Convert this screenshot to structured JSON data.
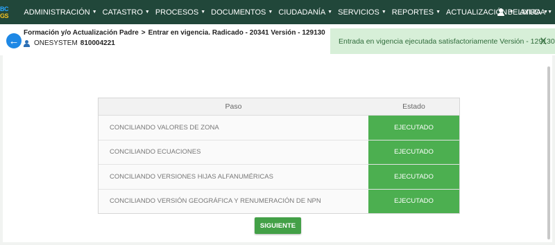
{
  "app": {
    "logo_line1": "BC",
    "logo_line2": "GS"
  },
  "nav": {
    "items": [
      {
        "label": "ADMINISTRACIÓN"
      },
      {
        "label": "CATASTRO"
      },
      {
        "label": "PROCESOS"
      },
      {
        "label": "DOCUMENTOS"
      },
      {
        "label": "CIUDADANÍA"
      },
      {
        "label": "SERVICIOS"
      },
      {
        "label": "REPORTES"
      },
      {
        "label": "ACTUALIZACIÓN"
      },
      {
        "label": "AYUDA"
      }
    ],
    "user": "BELMIRA"
  },
  "header": {
    "breadcrumb_1": "Formación y/o Actualización Padre",
    "breadcrumb_sep": ">",
    "breadcrumb_2": "Entrar en vigencia. Radicado - 20341 Versión - 129130",
    "owner_name": "ONESYSTEM",
    "owner_id": "810004221"
  },
  "alert": {
    "message": "Entrada en vigencia ejecutada satisfactoriamente Versión - 129130",
    "close_label": "X"
  },
  "table": {
    "col_step": "Paso",
    "col_state": "Estado",
    "rows": [
      {
        "step": "CONCILIANDO VALORES DE ZONA",
        "state": "EJECUTADO"
      },
      {
        "step": "CONCILIANDO ECUACIONES",
        "state": "EJECUTADO"
      },
      {
        "step": "CONCILIANDO VERSIONES HIJAS ALFANUMÉRICAS",
        "state": "EJECUTADO"
      },
      {
        "step": "CONCILIANDO VERSIÓN GEOGRÁFICA Y RENUMERACIÓN DE NPN",
        "state": "EJECUTADO"
      }
    ]
  },
  "actions": {
    "next_label": "SIGUIENTE"
  },
  "colors": {
    "topbar": "#21473a",
    "success": "#4caf50",
    "alert_bg": "#d7efd8",
    "back_button": "#1e88e5"
  },
  "icons": {
    "back": "arrow-left-icon",
    "user": "person-icon",
    "caret": "caret-down-icon"
  }
}
